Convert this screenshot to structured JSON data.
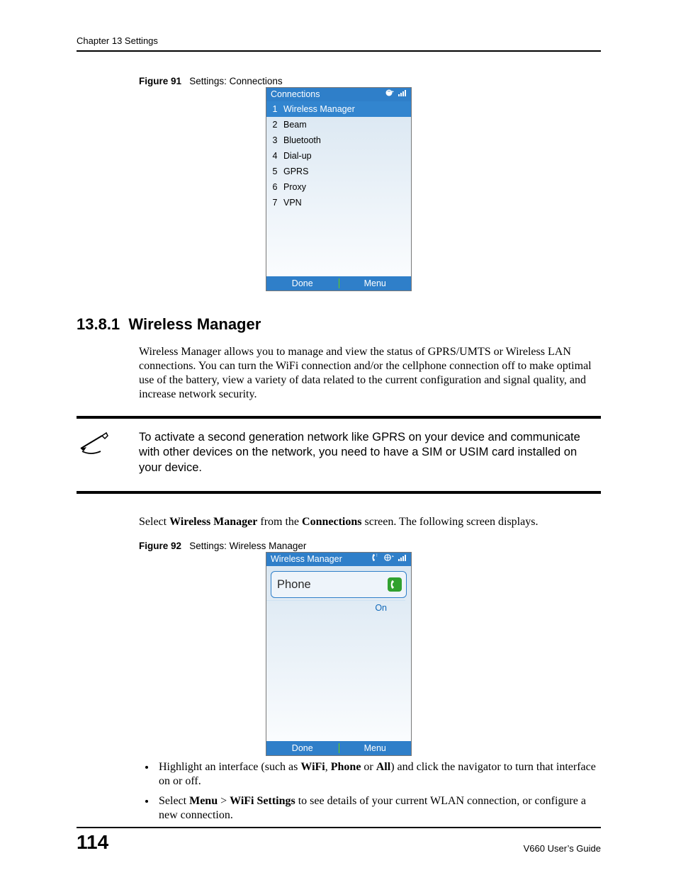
{
  "header": {
    "chapter_line": "Chapter 13 Settings"
  },
  "figure91": {
    "num": "Figure 91",
    "caption": "Settings: Connections",
    "phone": {
      "title": "Connections",
      "items": [
        {
          "n": "1",
          "label": "Wireless Manager",
          "selected": true
        },
        {
          "n": "2",
          "label": "Beam"
        },
        {
          "n": "3",
          "label": "Bluetooth"
        },
        {
          "n": "4",
          "label": "Dial-up"
        },
        {
          "n": "5",
          "label": "GPRS"
        },
        {
          "n": "6",
          "label": "Proxy"
        },
        {
          "n": "7",
          "label": "VPN"
        }
      ],
      "softkeys": {
        "left": "Done",
        "right": "Menu"
      }
    }
  },
  "section": {
    "number": "13.8.1",
    "title": "Wireless Manager"
  },
  "para1": "Wireless Manager allows you to manage and view the status of GPRS/UMTS or Wireless LAN connections. You can turn the WiFi connection and/or the cellphone connection off to make optimal use of the battery, view a variety of data related to the current configuration and signal quality, and increase network security.",
  "note": "To activate a second generation network like GPRS on your device and communicate with other devices on the network, you need to have a SIM or USIM card installed on your device.",
  "para2": {
    "pre": "Select ",
    "b1": "Wireless Manager",
    "mid": " from the ",
    "b2": "Connections",
    "post": " screen. The following screen displays."
  },
  "figure92": {
    "num": "Figure 92",
    "caption": "Settings: Wireless Manager",
    "phone": {
      "title": "Wireless Manager",
      "card": {
        "name": "Phone",
        "status": "On"
      },
      "softkeys": {
        "left": "Done",
        "right": "Menu"
      }
    }
  },
  "bullets": {
    "b1": {
      "pre": "Highlight an interface (such as ",
      "bw1": "WiFi",
      "c1": ", ",
      "bw2": "Phone",
      "c2": " or ",
      "bw3": "All",
      "post": ") and click the navigator to turn that interface on or off."
    },
    "b2": {
      "pre": "Select ",
      "bw1": "Menu",
      "c1": " > ",
      "bw2": "WiFi Settings",
      "post": " to see details of your current WLAN connection, or configure a new connection."
    }
  },
  "footer": {
    "page": "114",
    "guide": "V660 User’s Guide"
  },
  "icons": {
    "globe": "globe-icon",
    "signal": "signal-icon",
    "phone-small": "phone-mini-icon",
    "handset": "handset-icon",
    "note": "note-icon"
  }
}
